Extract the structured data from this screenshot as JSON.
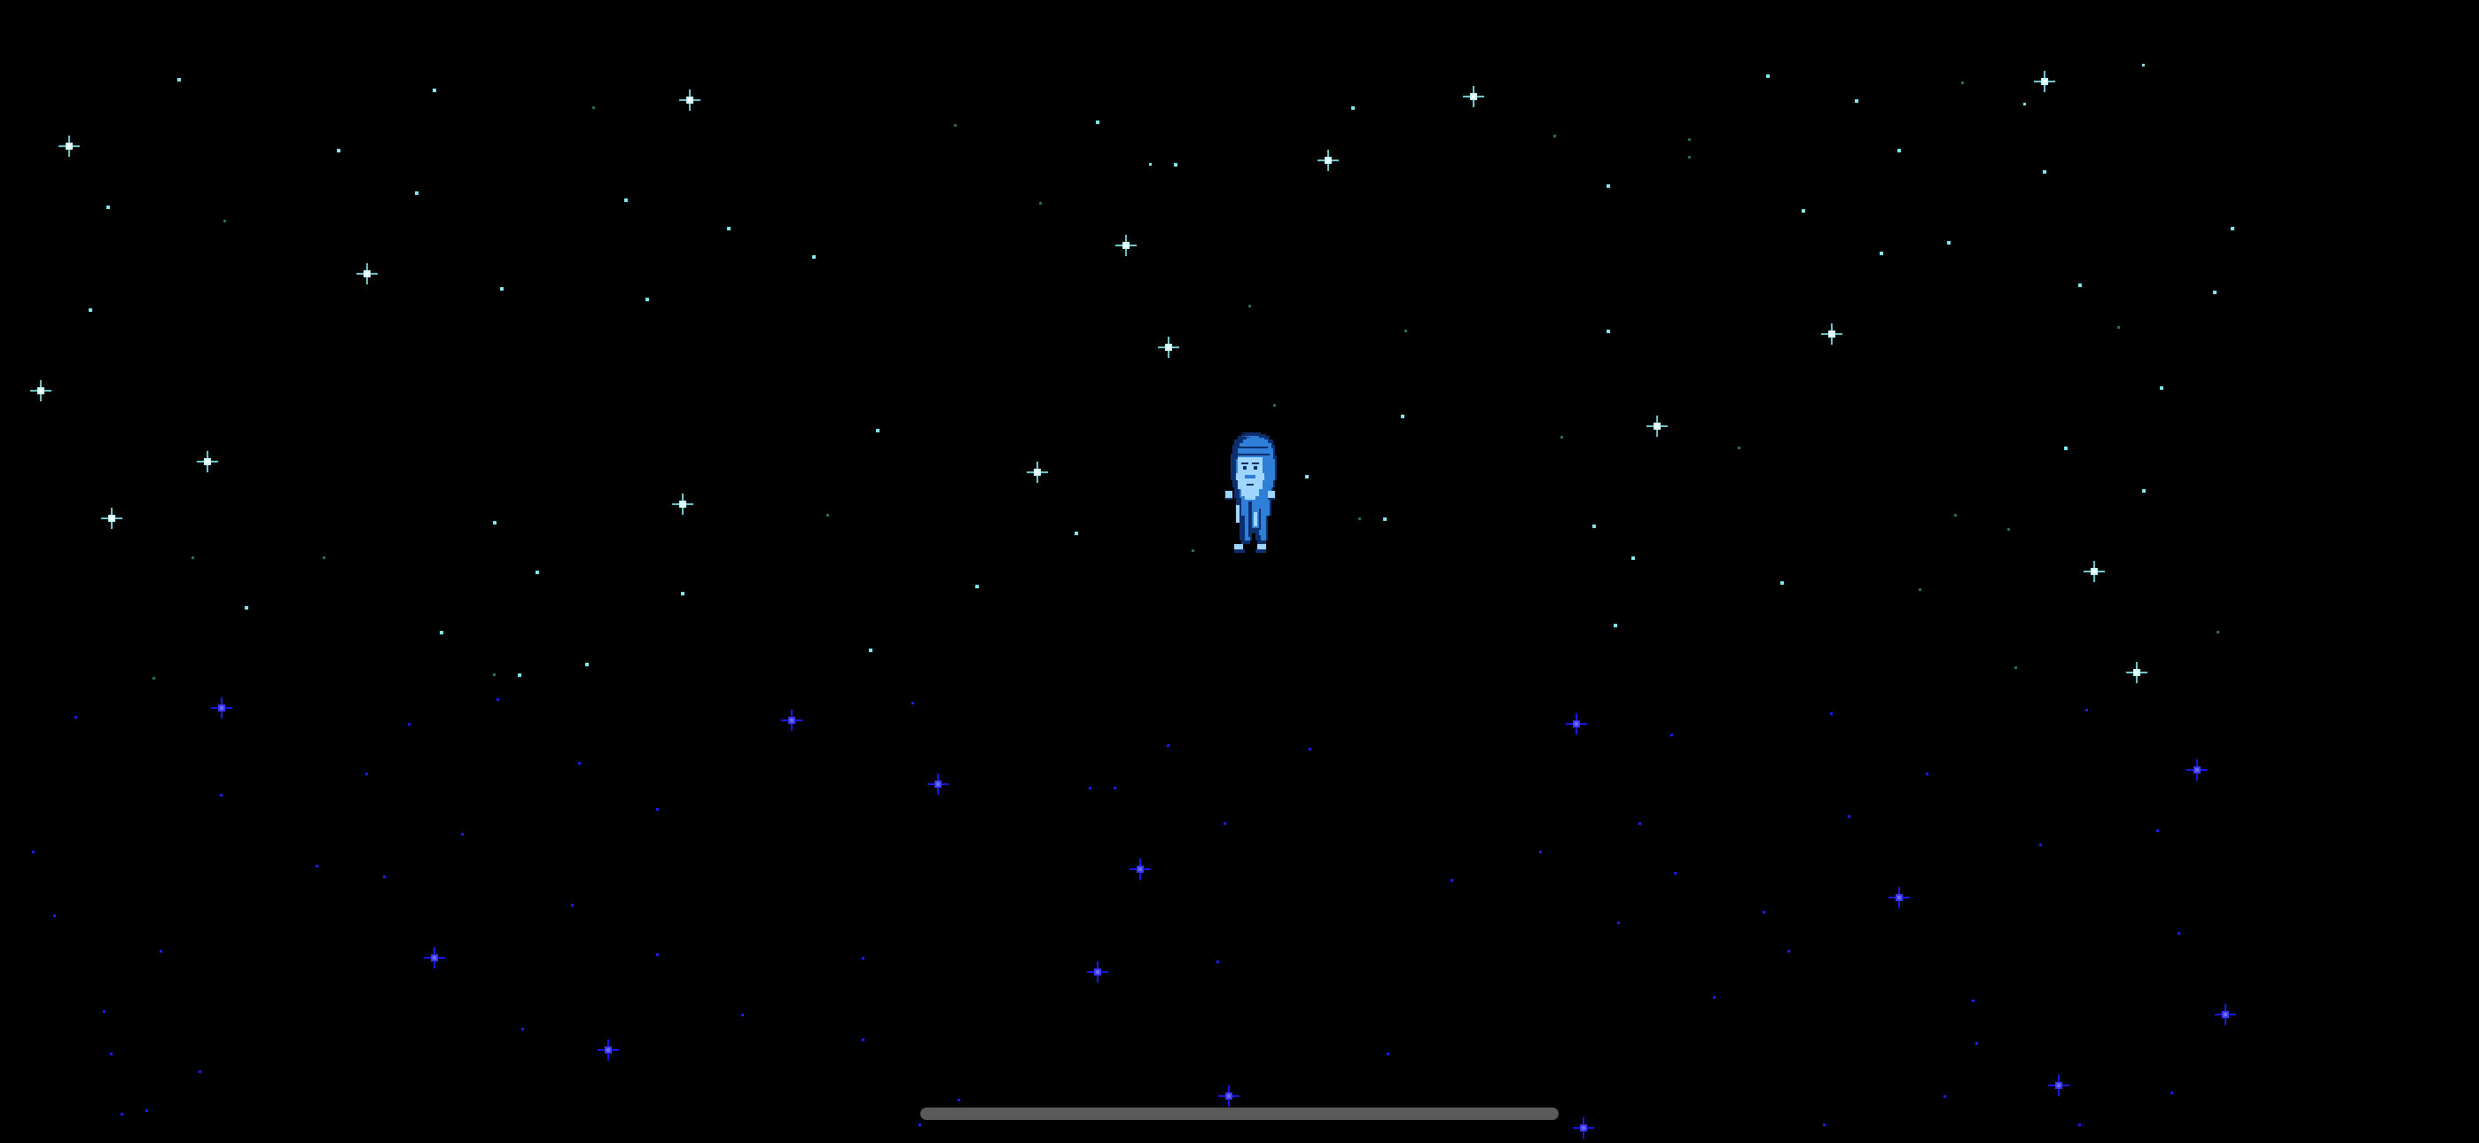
{
  "scene": {
    "background_color": "#000000",
    "upper_star_color": "#7fe6ec",
    "upper_sparkle_color": "#c8ffff",
    "lower_star_color": "#1a1aff",
    "lower_sparkle_color": "#3a3aff"
  },
  "character": {
    "icon": "hooded-bearded-old-man-sprite",
    "outline_color": "#0d2f6e",
    "body_color": "#2f7fd8",
    "highlight_color": "#9fd6ff"
  },
  "home_indicator": {
    "color": "#5a5a5a"
  }
}
